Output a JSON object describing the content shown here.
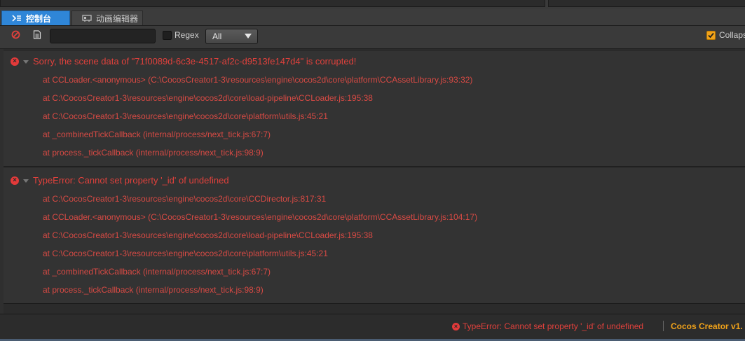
{
  "tabs": [
    {
      "label": "控制台",
      "icon": "console-icon",
      "active": true
    },
    {
      "label": "动画编辑器",
      "icon": "animation-editor-icon",
      "active": false
    }
  ],
  "toolbar": {
    "clear_icon": "clear-icon",
    "open_log_icon": "open-log-file-icon",
    "search_value": "",
    "regex_label": "Regex",
    "regex_checked": false,
    "level_select": "All",
    "collapse_label": "Collapse",
    "collapse_checked": true
  },
  "logs": [
    {
      "message": "Sorry, the scene data of \"71f0089d-6c3e-4517-af2c-d9513fe147d4\" is corrupted!",
      "stack": [
        "at CCLoader.<anonymous> (C:\\CocosCreator1-3\\resources\\engine\\cocos2d\\core\\platform\\CCAssetLibrary.js:93:32)",
        "at C:\\CocosCreator1-3\\resources\\engine\\cocos2d\\core\\load-pipeline\\CCLoader.js:195:38",
        "at C:\\CocosCreator1-3\\resources\\engine\\cocos2d\\core\\platform\\utils.js:45:21",
        "at _combinedTickCallback (internal/process/next_tick.js:67:7)",
        "at process._tickCallback (internal/process/next_tick.js:98:9)"
      ]
    },
    {
      "message": "TypeError: Cannot set property '_id' of undefined",
      "stack": [
        "at C:\\CocosCreator1-3\\resources\\engine\\cocos2d\\core\\CCDirector.js:817:31",
        "at CCLoader.<anonymous> (C:\\CocosCreator1-3\\resources\\engine\\cocos2d\\core\\platform\\CCAssetLibrary.js:104:17)",
        "at C:\\CocosCreator1-3\\resources\\engine\\cocos2d\\core\\load-pipeline\\CCLoader.js:195:38",
        "at C:\\CocosCreator1-3\\resources\\engine\\cocos2d\\core\\platform\\utils.js:45:21",
        "at _combinedTickCallback (internal/process/next_tick.js:67:7)",
        "at process._tickCallback (internal/process/next_tick.js:98:9)"
      ]
    }
  ],
  "status": {
    "last_error": "TypeError: Cannot set property '_id' of undefined",
    "brand": "Cocos Creator v1.",
    "error_color": "#e0413c",
    "brand_color": "#f0a21a"
  }
}
